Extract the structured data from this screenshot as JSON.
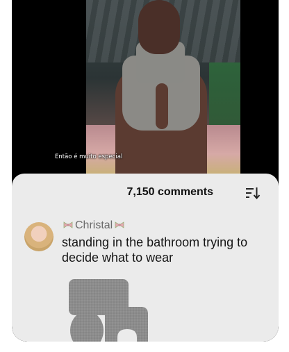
{
  "video": {
    "caption": "Então é muito especial"
  },
  "comments": {
    "count_label": "7,150 comments"
  },
  "comment": {
    "username": "Christal",
    "text": "standing in the bathroom trying to decide what to wear",
    "image_icon": "bathroom-mat-set"
  },
  "icons": {
    "sort": "sort-icon",
    "username_decor": "bow-icon"
  },
  "colors": {
    "sheet_bg": "#ebebeb",
    "username": "#6b6b6b",
    "text": "#151515"
  }
}
